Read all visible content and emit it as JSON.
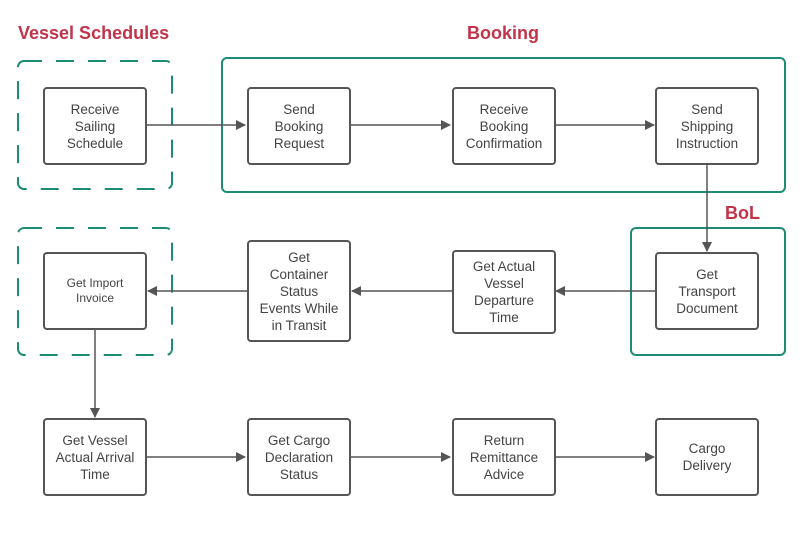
{
  "colors": {
    "group_border": "#1e8c74",
    "group_title": "#c0344a",
    "node_border": "#555555",
    "arrow": "#555555",
    "text": "#444444"
  },
  "groups": [
    {
      "id": "vessel-schedules",
      "title": "Vessel Schedules",
      "style": "dashed"
    },
    {
      "id": "booking",
      "title": "Booking",
      "style": "solid"
    },
    {
      "id": "bol",
      "title": "BoL",
      "style": "solid"
    },
    {
      "id": "import-invoice",
      "title": "",
      "style": "dashed"
    }
  ],
  "nodes": [
    {
      "id": "receive-sailing-schedule",
      "label": "Receive\nSailing\nSchedule"
    },
    {
      "id": "send-booking-request",
      "label": "Send\nBooking\nRequest"
    },
    {
      "id": "receive-booking-confirmation",
      "label": "Receive\nBooking\nConfirmation"
    },
    {
      "id": "send-shipping-instruction",
      "label": "Send\nShipping\nInstruction"
    },
    {
      "id": "get-transport-document",
      "label": "Get\nTransport\nDocument"
    },
    {
      "id": "get-actual-vessel-departure-time",
      "label": "Get Actual\nVessel\nDeparture\nTime"
    },
    {
      "id": "get-container-status-events",
      "label": "Get\nContainer\nStatus\nEvents While\nin Transit"
    },
    {
      "id": "get-import-invoice",
      "label": "Get Import\nInvoice"
    },
    {
      "id": "get-vessel-actual-arrival-time",
      "label": "Get Vessel\nActual Arrival\nTime"
    },
    {
      "id": "get-cargo-declaration-status",
      "label": "Get Cargo\nDeclaration\nStatus"
    },
    {
      "id": "return-remittance-advice",
      "label": "Return\nRemittance\nAdvice"
    },
    {
      "id": "cargo-delivery",
      "label": "Cargo\nDelivery"
    }
  ],
  "edges": [
    {
      "from": "receive-sailing-schedule",
      "to": "send-booking-request"
    },
    {
      "from": "send-booking-request",
      "to": "receive-booking-confirmation"
    },
    {
      "from": "receive-booking-confirmation",
      "to": "send-shipping-instruction"
    },
    {
      "from": "send-shipping-instruction",
      "to": "get-transport-document"
    },
    {
      "from": "get-transport-document",
      "to": "get-actual-vessel-departure-time"
    },
    {
      "from": "get-actual-vessel-departure-time",
      "to": "get-container-status-events"
    },
    {
      "from": "get-container-status-events",
      "to": "get-import-invoice"
    },
    {
      "from": "get-import-invoice",
      "to": "get-vessel-actual-arrival-time"
    },
    {
      "from": "get-vessel-actual-arrival-time",
      "to": "get-cargo-declaration-status"
    },
    {
      "from": "get-cargo-declaration-status",
      "to": "return-remittance-advice"
    },
    {
      "from": "return-remittance-advice",
      "to": "cargo-delivery"
    }
  ]
}
